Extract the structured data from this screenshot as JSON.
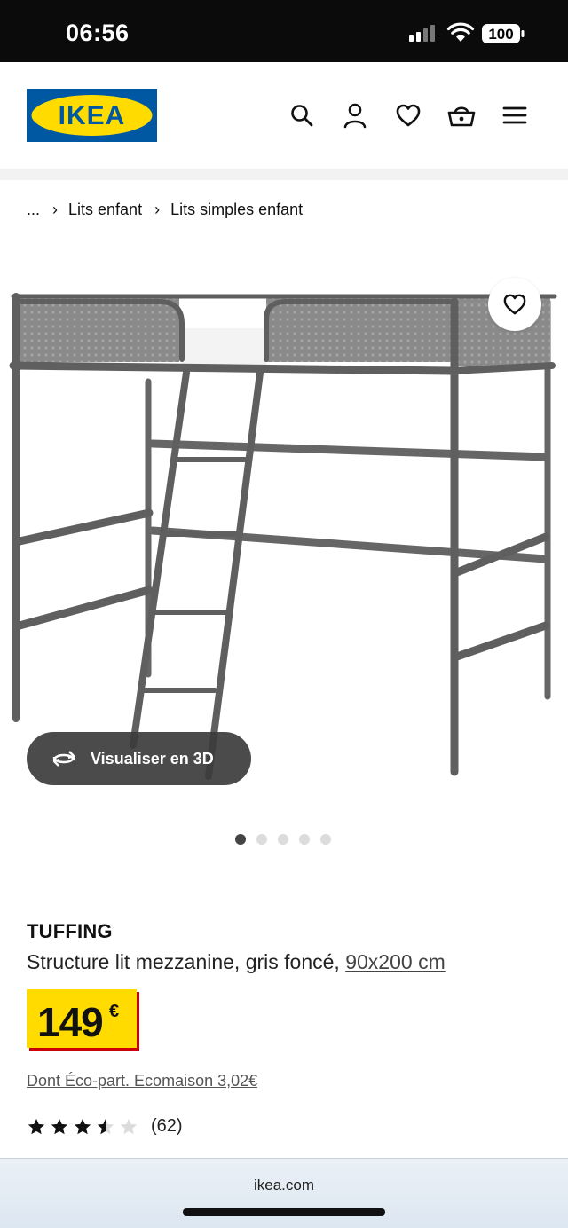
{
  "status_bar": {
    "time": "06:56",
    "battery": "100"
  },
  "header": {
    "logo_text": "IKEA",
    "icons": [
      "search-icon",
      "account-icon",
      "heart-icon",
      "basket-icon",
      "menu-icon"
    ]
  },
  "breadcrumb": {
    "ellipsis": "...",
    "items": [
      "Lits enfant",
      "Lits simples enfant"
    ]
  },
  "gallery": {
    "view_3d_label": "Visualiser en 3D",
    "dot_count": 5,
    "active_dot": 0
  },
  "product": {
    "name": "TUFFING",
    "description": "Structure lit mezzanine, gris foncé,",
    "size": "90x200 cm",
    "price": "149",
    "currency": "€",
    "eco_part": "Dont Éco-part. Ecomaison 3,02€",
    "rating_value": 3.5,
    "rating_max": 5,
    "rating_count": "(62)"
  },
  "browser": {
    "url": "ikea.com"
  },
  "colors": {
    "ikea_blue": "#0058a3",
    "ikea_yellow": "#ffdb00",
    "price_shadow": "#cc0008",
    "frame_gray": "#6e6e6e"
  }
}
